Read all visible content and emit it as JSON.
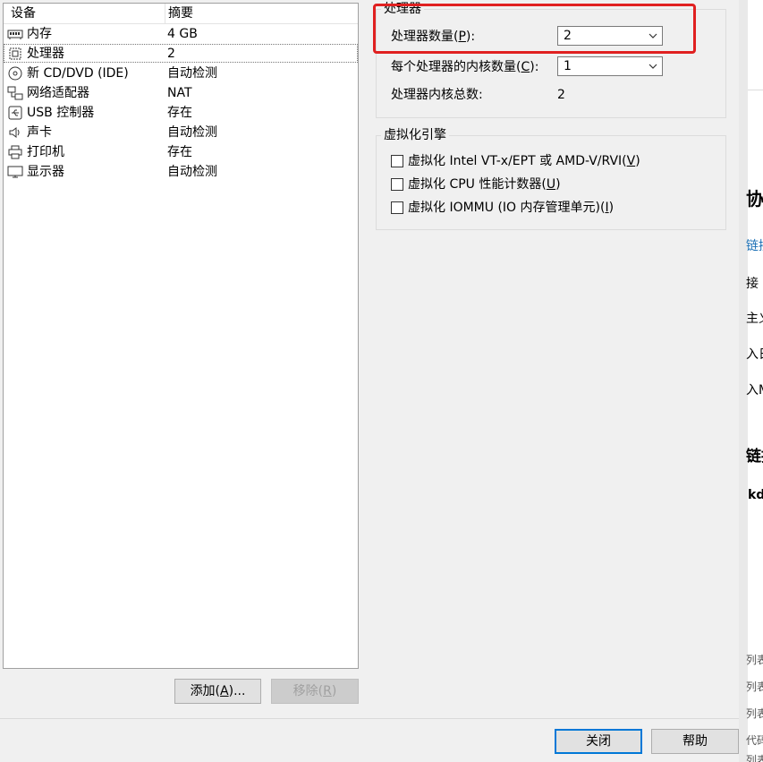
{
  "device_list": {
    "col_device": "设备",
    "col_summary": "摘要",
    "rows": [
      {
        "name": "内存",
        "value": "4 GB",
        "icon": "memory-icon"
      },
      {
        "name": "处理器",
        "value": "2",
        "icon": "cpu-icon",
        "selected": true
      },
      {
        "name": "新 CD/DVD (IDE)",
        "value": "自动检测",
        "icon": "cd-icon"
      },
      {
        "name": "网络适配器",
        "value": "NAT",
        "icon": "network-icon"
      },
      {
        "name": "USB 控制器",
        "value": "存在",
        "icon": "usb-icon"
      },
      {
        "name": "声卡",
        "value": "自动检测",
        "icon": "sound-icon"
      },
      {
        "name": "打印机",
        "value": "存在",
        "icon": "printer-icon"
      },
      {
        "name": "显示器",
        "value": "自动检测",
        "icon": "monitor-icon"
      }
    ]
  },
  "buttons": {
    "add_text": "添加(",
    "add_key": "A",
    "add_suffix": ")...",
    "remove_text": "移除(",
    "remove_key": "R",
    "remove_suffix": ")",
    "close": "关闭",
    "help": "帮助"
  },
  "processor": {
    "group_title": "处理器",
    "count_label_text": "处理器数量(",
    "count_label_key": "P",
    "count_label_suffix": "):",
    "count_value": "2",
    "cores_label_text": "每个处理器的内核数量(",
    "cores_label_key": "C",
    "cores_label_suffix": "):",
    "cores_value": "1",
    "total_label": "处理器内核总数:",
    "total_value": "2"
  },
  "virtualization": {
    "group_title": "虚拟化引擎",
    "options": [
      {
        "text": "虚拟化 Intel VT-x/EPT 或 AMD-V/RVI(",
        "key": "V",
        "suffix": ")",
        "checked": false
      },
      {
        "text": "虚拟化 CPU 性能计数器(",
        "key": "U",
        "suffix": ")",
        "checked": false
      },
      {
        "text": "虚拟化 IOMMU (IO 内存管理单元)(",
        "key": "I",
        "suffix": ")",
        "checked": false
      }
    ]
  },
  "background_fragments": [
    "协义",
    "链接",
    "接",
    "主义",
    "入日",
    "入M",
    "链接",
    "kd",
    "列表",
    "列表",
    "列表",
    "代码",
    "列表"
  ],
  "colors": {
    "highlight": "#e02020",
    "default_button_border": "#0078d7",
    "background_link": "#1a6fb5"
  }
}
